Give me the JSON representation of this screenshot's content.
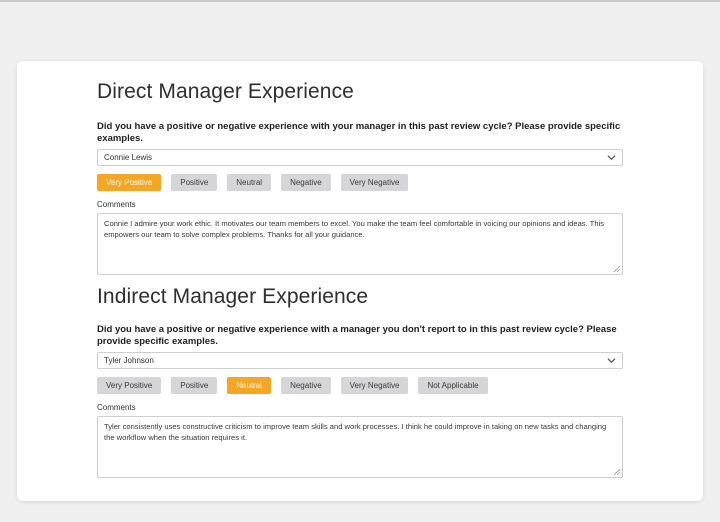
{
  "colors": {
    "accent": "#f5a623",
    "button_bg": "#d6d6d8",
    "card_bg": "#ffffff"
  },
  "direct": {
    "title": "Direct Manager Experience",
    "question": "Did you have a positive or negative experience with your manager in this past review cycle? Please provide specific examples.",
    "manager": "Connie Lewis",
    "options": [
      "Very Positive",
      "Positive",
      "Neutral",
      "Negative",
      "Very Negative"
    ],
    "selected": "Very Positive",
    "comments_label": "Comments",
    "comment": "Connie I admire your work ethic. It motivates our team members to excel. You make the team feel comfortable in voicing our opinions and ideas. This empowers our team to solve complex problems. Thanks for all your guidance."
  },
  "indirect": {
    "title": "Indirect Manager Experience",
    "question": "Did you have a positive or negative experience with a manager you don't report to in this past review cycle? Please provide specific examples.",
    "manager": "Tyler Johnson",
    "options": [
      "Very Positive",
      "Positive",
      "Neutral",
      "Negative",
      "Very Negative",
      "Not Applicable"
    ],
    "selected": "Neutral",
    "comments_label": "Comments",
    "comment": "Tyler consistently uses constructive criticism to improve team skills and work processes. I think he could improve in taking on new tasks and changing  the workflow when the situation requires it."
  }
}
